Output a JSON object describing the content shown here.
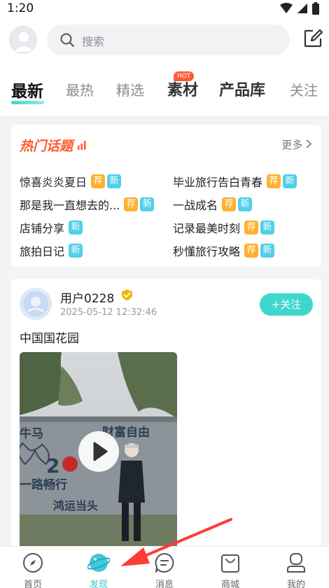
{
  "status": {
    "time": "1:20"
  },
  "search": {
    "placeholder": "搜索"
  },
  "tabs": [
    {
      "label": "最新",
      "active": true
    },
    {
      "label": "最热"
    },
    {
      "label": "精选"
    },
    {
      "label": "素材",
      "badge": "HOT"
    },
    {
      "label": "产品库"
    },
    {
      "label": "关注"
    }
  ],
  "topics": {
    "title": "热门话题",
    "more": "更多",
    "tag_rec": "荐",
    "tag_new": "新",
    "items": [
      {
        "label": "惊喜炎炎夏日",
        "tags": [
          "荐",
          "新"
        ]
      },
      {
        "label": "毕业旅行告白青春",
        "tags": [
          "荐",
          "新"
        ]
      },
      {
        "label": "那是我一直想去的...",
        "tags": [
          "荐",
          "新"
        ]
      },
      {
        "label": "一战成名",
        "tags": [
          "荐",
          "新"
        ]
      },
      {
        "label": "店铺分享",
        "tags": [
          "新"
        ]
      },
      {
        "label": "记录最美时刻",
        "tags": [
          "荐",
          "新"
        ]
      },
      {
        "label": "旅拍日记",
        "tags": [
          "新"
        ]
      },
      {
        "label": "秒懂旅行攻略",
        "tags": [
          "荐",
          "新"
        ]
      }
    ]
  },
  "post": {
    "username": "用户0228",
    "time": "2025-05-12 12:32:46",
    "follow_label": "+关注",
    "text": "中国国花园",
    "video_sign_text": [
      "牛马",
      "财富自由",
      "一路畅行",
      "鸿运当头",
      "2"
    ]
  },
  "nav": [
    {
      "label": "首页",
      "icon": "compass-icon"
    },
    {
      "label": "发现",
      "icon": "planet-icon",
      "active": true
    },
    {
      "label": "消息",
      "icon": "message-icon"
    },
    {
      "label": "商城",
      "icon": "shopping-bag-icon"
    },
    {
      "label": "我的",
      "icon": "user-icon"
    }
  ],
  "colors": {
    "accent": "#3fd6cd",
    "hot": "#ff5a2e",
    "rec_tag": "#ffb02e",
    "new_tag": "#4fd0e8",
    "arrow": "#ff3b36"
  }
}
